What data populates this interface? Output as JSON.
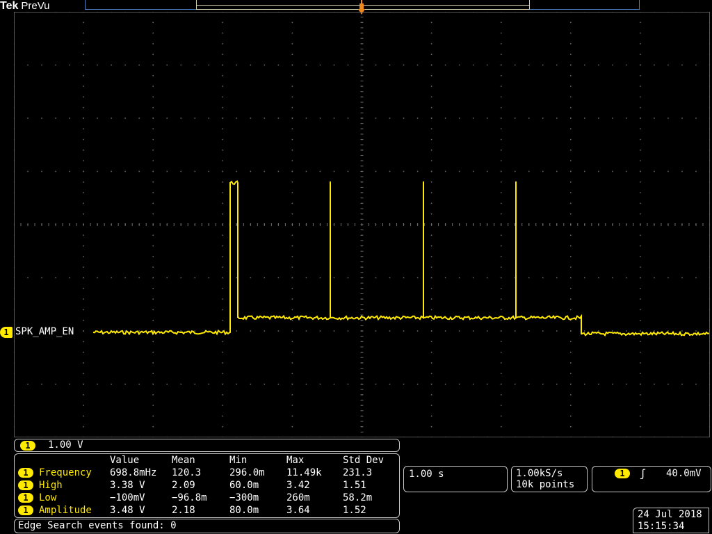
{
  "header": {
    "brand": "Tek",
    "mode": "PreVu"
  },
  "channel": {
    "number": "1",
    "label": "SPK_AMP_EN",
    "color": "#ffea00"
  },
  "vertical": {
    "badge": "1",
    "scale": "1.00 V"
  },
  "measurements": {
    "headers": [
      "Value",
      "Mean",
      "Min",
      "Max",
      "Std Dev"
    ],
    "rows": [
      {
        "badge": "1",
        "name": "Frequency",
        "value": "698.8mHz",
        "mean": "120.3",
        "min": "296.0m",
        "max": "11.49k",
        "std": "231.3"
      },
      {
        "badge": "1",
        "name": "High",
        "value": "3.38 V",
        "mean": "2.09",
        "min": "60.0m",
        "max": "3.42",
        "std": "1.51"
      },
      {
        "badge": "1",
        "name": "Low",
        "value": "−100mV",
        "mean": "−96.8m",
        "min": "−300m",
        "max": "260m",
        "std": "58.2m"
      },
      {
        "badge": "1",
        "name": "Amplitude",
        "value": "3.48 V",
        "mean": "2.18",
        "min": "80.0m",
        "max": "3.64",
        "std": "1.52"
      }
    ]
  },
  "search": {
    "text": "Edge Search events found: 0"
  },
  "horizontal": {
    "time_per_div": "1.00 s"
  },
  "acquisition": {
    "sample_rate": "1.00kS/s",
    "record_length": "10k points"
  },
  "trigger": {
    "badge": "1",
    "slope_icon": "rising-edge-icon",
    "slope_glyph": "ʃ",
    "level": "40.0mV"
  },
  "datetime": {
    "date": "24 Jul  2018",
    "time": "15:15:34"
  },
  "icons": {
    "trigger_marker": "trigger-position-icon"
  },
  "colors": {
    "trace": "#ffea00",
    "grid": "#6f6f6f",
    "record_bar": "#4a7fc0",
    "trigger_marker": "#f08a1c"
  }
}
